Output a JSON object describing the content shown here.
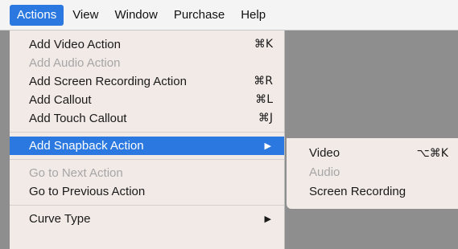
{
  "menubar": {
    "items": [
      {
        "label": "Actions"
      },
      {
        "label": "View"
      },
      {
        "label": "Window"
      },
      {
        "label": "Purchase"
      },
      {
        "label": "Help"
      }
    ]
  },
  "menu": {
    "items": [
      {
        "label": "Add Video Action",
        "shortcut": "⌘K"
      },
      {
        "label": "Add Audio Action",
        "shortcut": ""
      },
      {
        "label": "Add Screen Recording Action",
        "shortcut": "⌘R"
      },
      {
        "label": "Add Callout",
        "shortcut": "⌘L"
      },
      {
        "label": "Add Touch Callout",
        "shortcut": "⌘J"
      },
      {
        "label": "Add Snapback Action",
        "arrow": "▶"
      },
      {
        "label": "Go to Next Action"
      },
      {
        "label": "Go to Previous Action"
      },
      {
        "label": "Curve Type",
        "arrow": "▶"
      }
    ]
  },
  "submenu": {
    "items": [
      {
        "label": "Video",
        "shortcut": "⌥⌘K"
      },
      {
        "label": "Audio"
      },
      {
        "label": "Screen Recording"
      }
    ]
  },
  "colors": {
    "accent": "#2b79e0",
    "menu_background": "#f2eae6",
    "disabled_text": "#a6a6a6",
    "backdrop": "#8e8e8e"
  }
}
